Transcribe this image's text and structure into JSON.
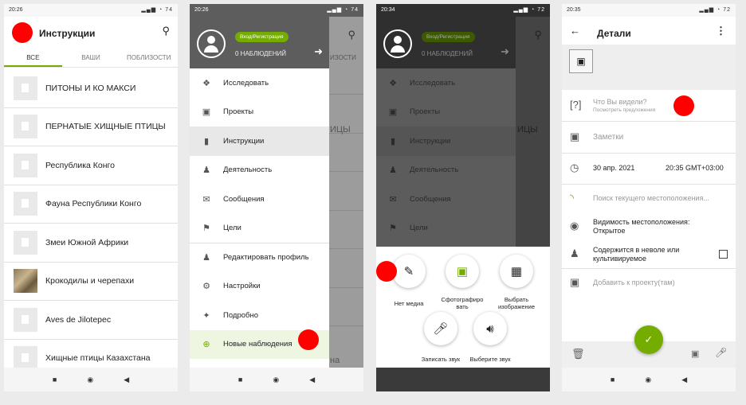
{
  "colors": {
    "accent": "#74ac00",
    "marker": "#ff0000",
    "drawer_header": "#5d5d5d"
  },
  "screen1": {
    "time": "20:26",
    "battery": "74",
    "title": "Инструкции",
    "tabs": [
      "ВСЕ",
      "ВАШИ",
      "ПОБЛИЗОСТИ"
    ],
    "guides": [
      "ПИТОНЫ И КО МАКСИ",
      "ПЕРНАТЫЕ ХИЩНЫЕ ПТИЦЫ",
      "Республика Конго",
      "Фауна Республики Конго",
      "Змеи Южной Африки",
      "Крокодилы и черепахи",
      "Aves de Jilotepec",
      "Хищные птицы Казахстана"
    ]
  },
  "screen2": {
    "time": "20:26",
    "battery": "74",
    "login_label": "Вход/Регистрация",
    "observations_label": "0 НАБЛЮДЕНИЙ",
    "behind_tab": "ИЗОСТИ",
    "behind_word1": "ИЦЫ",
    "behind_word2": "на",
    "menu": [
      {
        "label": "Исследовать",
        "icon": "compass-icon"
      },
      {
        "label": "Проекты",
        "icon": "briefcase-icon"
      },
      {
        "label": "Инструкции",
        "icon": "book-icon"
      },
      {
        "label": "Деятельность",
        "icon": "people-icon"
      },
      {
        "label": "Сообщения",
        "icon": "mail-icon"
      },
      {
        "label": "Цели",
        "icon": "flag-icon"
      },
      {
        "label": "Редактировать профиль",
        "icon": "person-icon"
      },
      {
        "label": "Настройки",
        "icon": "gear-icon"
      },
      {
        "label": "Подробно",
        "icon": "bird-icon"
      },
      {
        "label": "Новые наблюдения",
        "icon": "plus-circle-icon"
      }
    ]
  },
  "screen3": {
    "time": "20:34",
    "battery": "72",
    "login_label": "Вход/Регистрация",
    "observations_label": "0 НАБЛЮДЕНИЙ",
    "behind_word": "ИЦЫ",
    "menu": [
      "Исследовать",
      "Проекты",
      "Инструкции",
      "Деятельность",
      "Сообщения",
      "Цели"
    ],
    "options": {
      "no_media": "Нет медиа",
      "take_photo": "Сфотографиро вать",
      "choose_image": "Выбрать изображение",
      "record_sound": "Записать звук",
      "choose_sound": "Выберите звук"
    }
  },
  "screen4": {
    "time": "20:35",
    "battery": "72",
    "title": "Детали",
    "what_seen": "Что Вы видели?",
    "view_suggestions": "Посмотреть предложения",
    "notes": "Заметки",
    "date": "30 апр. 2021",
    "time_value": "20:35 GMT+03:00",
    "location_search": "Поиск текущего местоположения...",
    "location_visibility": "Видимость местоположения: Открытое",
    "captive": "Содержится в неволе или культивируемое",
    "add_project": "Добавить к проекту(там)"
  }
}
